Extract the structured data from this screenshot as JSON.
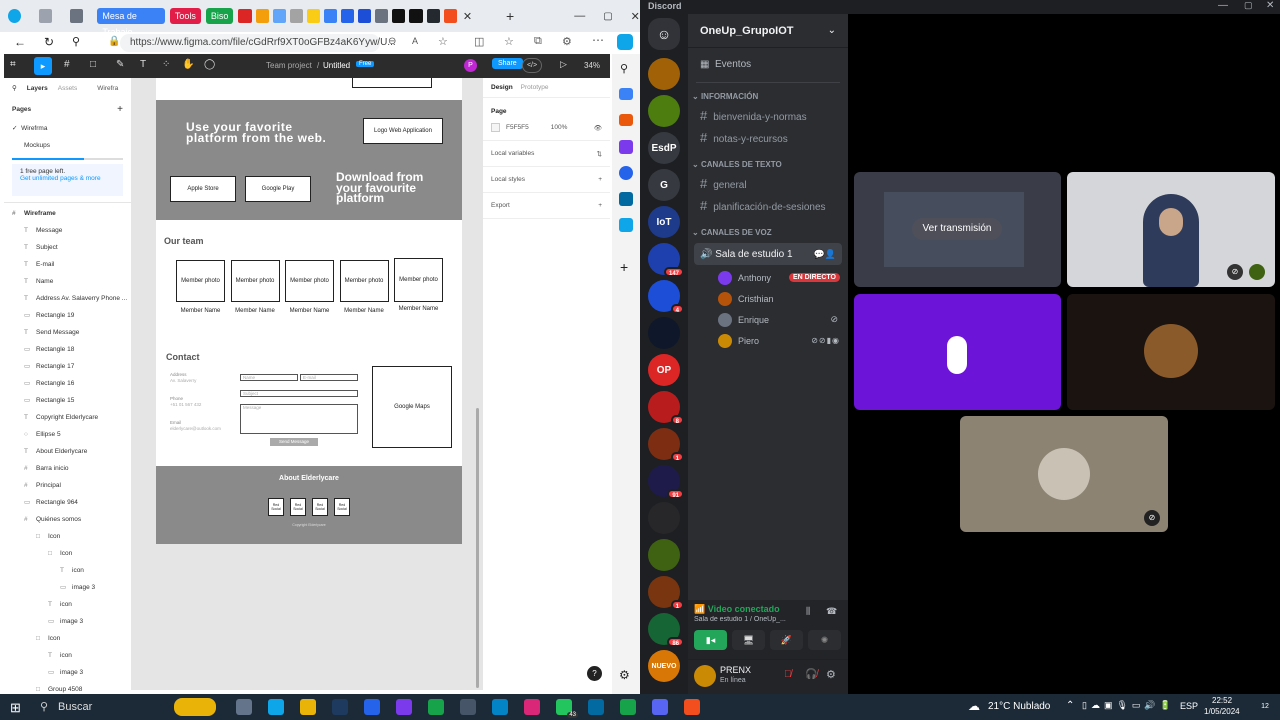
{
  "discord_title": "Discord",
  "browser": {
    "pinned_tabs": [
      {
        "label": "Mesa de Trabajo",
        "color": "#3b82f6"
      },
      {
        "label": "Tools",
        "color": "#e11d48"
      },
      {
        "label": "Biso",
        "color": "#16a34a"
      }
    ],
    "url": "https://www.figma.com/file/cGdRrf9XT0oGFBz4aK6Yyw/U..."
  },
  "figma": {
    "toolbar": {
      "project": "Team project",
      "file": "Untitled",
      "plan": "Free",
      "avatar": "P",
      "share": "Share",
      "zoom": "34%"
    },
    "layers_tabs": [
      "Layers",
      "Assets",
      "Wirefra"
    ],
    "pages_title": "Pages",
    "pages": [
      "Wirefrma",
      "Mockups"
    ],
    "free_left": "1 free page left.",
    "upgrade": "Get unlimited pages & more",
    "layers": [
      {
        "name": "Wireframe",
        "indent": 0,
        "icon": "#"
      },
      {
        "name": "Message",
        "indent": 1,
        "icon": "T"
      },
      {
        "name": "Subject",
        "indent": 1,
        "icon": "T"
      },
      {
        "name": "E-mail",
        "indent": 1,
        "icon": "T"
      },
      {
        "name": "Name",
        "indent": 1,
        "icon": "T"
      },
      {
        "name": "Address  Av. Salaverry Phone ...",
        "indent": 1,
        "icon": "T"
      },
      {
        "name": "Rectangle 19",
        "indent": 1,
        "icon": "▭"
      },
      {
        "name": "Send Message",
        "indent": 1,
        "icon": "T"
      },
      {
        "name": "Rectangle 18",
        "indent": 1,
        "icon": "▭"
      },
      {
        "name": "Rectangle 17",
        "indent": 1,
        "icon": "▭"
      },
      {
        "name": "Rectangle 16",
        "indent": 1,
        "icon": "▭"
      },
      {
        "name": "Rectangle 15",
        "indent": 1,
        "icon": "▭"
      },
      {
        "name": "Copyright Elderlycare",
        "indent": 1,
        "icon": "T"
      },
      {
        "name": "Ellipse 5",
        "indent": 1,
        "icon": "○"
      },
      {
        "name": "About Elderlycare",
        "indent": 1,
        "icon": "T"
      },
      {
        "name": "Barra inicio",
        "indent": 1,
        "icon": "#"
      },
      {
        "name": "Principal",
        "indent": 1,
        "icon": "#"
      },
      {
        "name": "Rectangle 964",
        "indent": 1,
        "icon": "▭"
      },
      {
        "name": "Quiénes somos",
        "indent": 1,
        "icon": "#"
      },
      {
        "name": "Icon",
        "indent": 2,
        "icon": "□"
      },
      {
        "name": "Icon",
        "indent": 3,
        "icon": "□"
      },
      {
        "name": "icon",
        "indent": 4,
        "icon": "T"
      },
      {
        "name": "image 3",
        "indent": 4,
        "icon": "▭"
      },
      {
        "name": "icon",
        "indent": 3,
        "icon": "T"
      },
      {
        "name": "image 3",
        "indent": 3,
        "icon": "▭"
      },
      {
        "name": "Icon",
        "indent": 2,
        "icon": "□"
      },
      {
        "name": "icon",
        "indent": 3,
        "icon": "T"
      },
      {
        "name": "image 3",
        "indent": 3,
        "icon": "▭"
      },
      {
        "name": "Group 4508",
        "indent": 2,
        "icon": "□"
      }
    ],
    "wire": {
      "hero_title": "Use your favorite platform from the web.",
      "logo_box": "Logo Web Application",
      "apple": "Apple Store",
      "gplay": "Google Play",
      "download": "Download from your favourite platform",
      "team_title": "Our team",
      "member_photo": "Member photo",
      "member_name": "Member Name",
      "contact_title": "Contact",
      "address_lbl": "Address",
      "address_val": "Av. Salaverry",
      "phone_lbl": "Phone",
      "phone_val": "+51 01 567 432",
      "email_lbl": "Email",
      "email_val": "elderlycare@outlook.com",
      "f_name": "Name",
      "f_email": "E-mail",
      "f_subject": "Subject",
      "f_message": "Message",
      "send": "Send Message",
      "maps": "Google Maps",
      "about": "About Elderlycare",
      "social": "Red Social",
      "copyright": "Copyright Elderlycare"
    },
    "design": {
      "tabs": [
        "Design",
        "Prototype"
      ],
      "page_lbl": "Page",
      "color_hex": "F5F5F5",
      "opacity": "100%",
      "sections": [
        "Local variables",
        "Local styles",
        "Export"
      ],
      "canvas_bg": "#f5f5f5"
    },
    "help": "?"
  },
  "discord": {
    "server_name": "OneUp_GrupoIOT",
    "events": "Eventos",
    "categories": {
      "info": "INFORMACIÓN",
      "text": "CANALES DE TEXTO",
      "voice": "CANALES DE VOZ"
    },
    "info_channels": [
      "bienvenida-y-normas",
      "notas-y-recursos"
    ],
    "text_channels": [
      "general",
      "planificación-de-sesiones"
    ],
    "voice_channel": "Sala de estudio 1",
    "live_badge": "EN DIRECTO",
    "members": [
      {
        "name": "Anthony",
        "color": "#7c3aed"
      },
      {
        "name": "Cristhian",
        "color": "#b45309"
      },
      {
        "name": "Enrique",
        "color": "#6b7280"
      },
      {
        "name": "Piero",
        "color": "#ca8a04"
      }
    ],
    "servers": [
      {
        "label": "",
        "color": "#a16207",
        "badge": ""
      },
      {
        "label": "",
        "color": "#4d7c0f",
        "badge": ""
      },
      {
        "label": "EsdP",
        "color": "#36393f",
        "badge": ""
      },
      {
        "label": "G",
        "color": "#36393f",
        "badge": ""
      },
      {
        "label": "IoT",
        "color": "#1e3a8a",
        "badge": ""
      },
      {
        "label": "",
        "color": "#1e40af",
        "badge": "147"
      },
      {
        "label": "",
        "color": "#1d4ed8",
        "badge": "4"
      },
      {
        "label": "",
        "color": "#0f172a",
        "badge": ""
      },
      {
        "label": "OP",
        "color": "#dc2626",
        "badge": ""
      },
      {
        "label": "",
        "color": "#b91c1c",
        "badge": "8"
      },
      {
        "label": "",
        "color": "#7c2d12",
        "badge": "1"
      },
      {
        "label": "",
        "color": "#1e1b4b",
        "badge": "91"
      },
      {
        "label": "",
        "color": "#27272a",
        "badge": ""
      },
      {
        "label": "",
        "color": "#3f6212",
        "badge": ""
      },
      {
        "label": "",
        "color": "#78350f",
        "badge": "1"
      },
      {
        "label": "",
        "color": "#166534",
        "badge": "86"
      },
      {
        "label": "NUEVO",
        "color": "#d97706",
        "badge": ""
      }
    ],
    "video_connected": "Video conectado",
    "connection_sub": "Sala de estudio 1 / OneUp_...",
    "user_name": "PRENX",
    "user_status": "En línea",
    "watch_stream": "Ver transmisión",
    "accent": "#5865f2",
    "purple_tile": "#6d14d9"
  },
  "taskbar": {
    "search": "Buscar",
    "weather": "21°C  Nublado",
    "lang": "ESP",
    "time": "22:52",
    "date": "1/05/2024",
    "notif": "12",
    "whatsapp_badge": "43"
  }
}
